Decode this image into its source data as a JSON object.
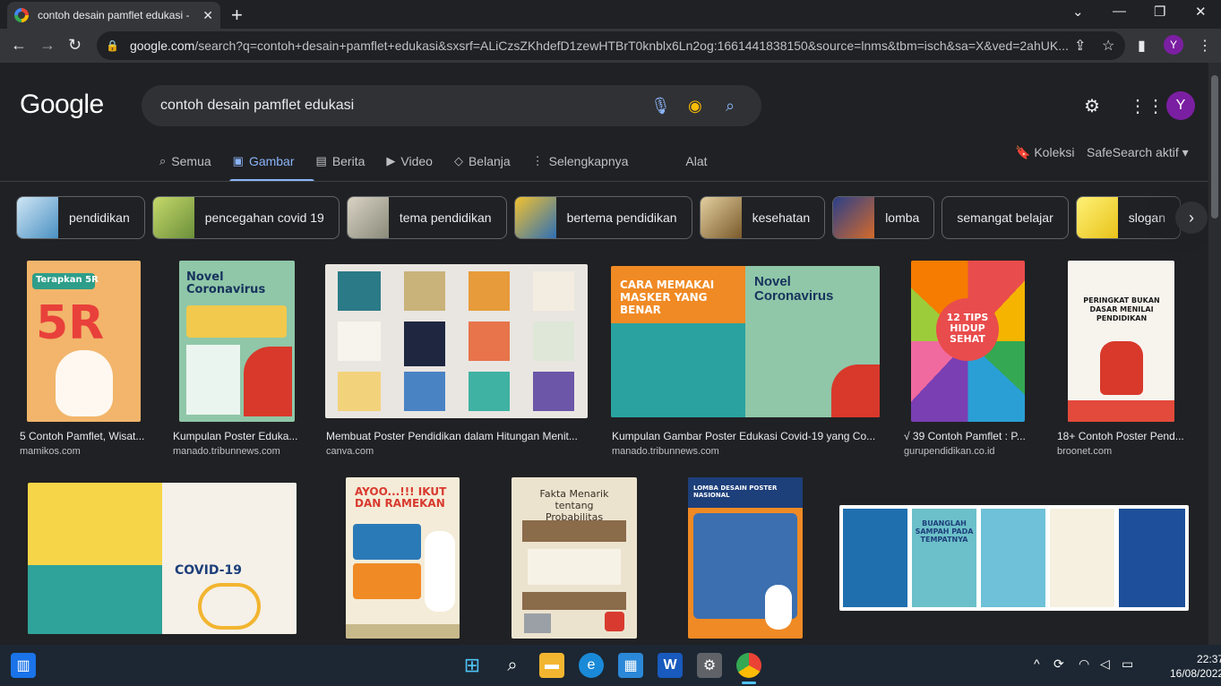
{
  "browser": {
    "tab_title": "contoh desain pamflet edukasi - ",
    "url_domain": "google.com",
    "url_rest": "/search?q=contoh+desain+pamflet+edukasi&sxsrf=ALiCzsZKhdefD1zewHTBrT0knblx6Ln2og:1661441838150&source=lnms&tbm=isch&sa=X&ved=2ahUK...",
    "profile_initial": "Y"
  },
  "header": {
    "logo": "Google",
    "query": "contoh desain pamflet edukasi",
    "avatar": "Y"
  },
  "nav": {
    "tabs": [
      {
        "label": "Semua",
        "icon": "search-icon"
      },
      {
        "label": "Gambar",
        "icon": "image-icon",
        "active": true
      },
      {
        "label": "Berita",
        "icon": "news-icon"
      },
      {
        "label": "Video",
        "icon": "video-icon"
      },
      {
        "label": "Belanja",
        "icon": "tag-icon"
      },
      {
        "label": "Selengkapnya",
        "icon": "more-icon"
      }
    ],
    "tools": "Alat",
    "collections": "Koleksi",
    "safesearch": "SafeSearch aktif"
  },
  "chips": [
    {
      "label": "pendidikan",
      "color": "#4a90c2"
    },
    {
      "label": "pencegahan covid 19",
      "color": "#6b8f3a"
    },
    {
      "label": "tema pendidikan",
      "color": "#8a8a7a"
    },
    {
      "label": "bertema pendidikan",
      "color": "#2e6fb5"
    },
    {
      "label": "kesehatan",
      "color": "#7a5a2a"
    },
    {
      "label": "lomba",
      "color": "#d46a2a"
    },
    {
      "label": "semangat belajar",
      "color": ""
    },
    {
      "label": "slogan",
      "color": "#e8c21a"
    }
  ],
  "results_row1": [
    {
      "caption": "5 Contoh Pamflet, Wisat...",
      "source": "mamikos.com",
      "poster": "Terapkan 5R"
    },
    {
      "caption": "Kumpulan Poster Eduka...",
      "source": "manado.tribunnews.com",
      "poster": "Novel Coronavirus"
    },
    {
      "caption": "Membuat Poster Pendidikan dalam Hitungan Menit...",
      "source": "canva.com",
      "poster": ""
    },
    {
      "caption": "Kumpulan Gambar Poster Edukasi Covid-19 yang Co...",
      "source": "manado.tribunnews.com",
      "poster": "CARA MEMAKAI MASKER YANG BENAR"
    },
    {
      "caption": "√ 39 Contoh Pamflet : P...",
      "source": "gurupendidikan.co.id",
      "poster": "12 TIPS HIDUP SEHAT"
    },
    {
      "caption": "18+ Contoh Poster Pend...",
      "source": "broonet.com",
      "poster": "PERINGKAT BUKAN DASAR MENILAI PENDIDIKAN"
    }
  ],
  "results_row2": [
    {
      "poster": "COVID-19"
    },
    {
      "poster": "AYOO...!!! IKUT DAN RAMEKAN"
    },
    {
      "poster": "Fakta Menarik tentang Probabilitas"
    },
    {
      "poster": "LOMBA DESAIN POSTER NASIONAL"
    },
    {
      "poster": "BUANGLAH SAMPAH PADA TEMPATNYA"
    }
  ],
  "taskbar": {
    "time": "22:37",
    "date": "16/08/2022"
  }
}
